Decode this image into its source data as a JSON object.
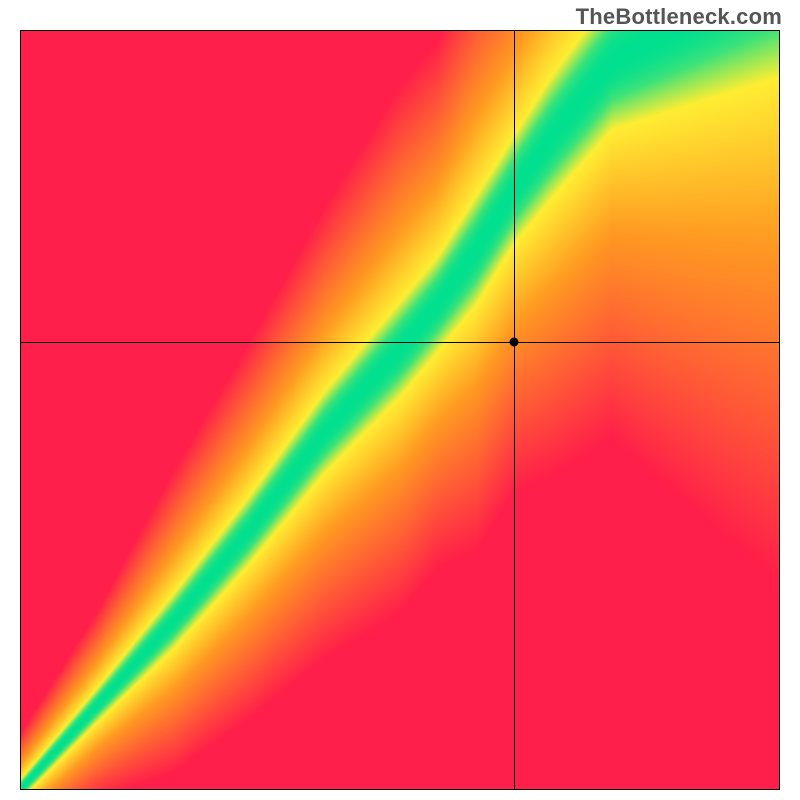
{
  "watermark": "TheBottleneck.com",
  "chart_data": {
    "type": "heatmap",
    "title": "",
    "xlabel": "",
    "ylabel": "",
    "xlim": [
      0,
      100
    ],
    "ylim": [
      0,
      100
    ],
    "grid": false,
    "legend": false,
    "crosshair": {
      "x": 65.2,
      "y": 58.8
    },
    "optimal_band": {
      "description": "Green band of optimal pairing; diagonal curve widening toward top-right",
      "points": [
        {
          "x": 0,
          "center": 0,
          "width": 1.5
        },
        {
          "x": 10,
          "center": 11,
          "width": 2.5
        },
        {
          "x": 20,
          "center": 22,
          "width": 4
        },
        {
          "x": 30,
          "center": 34,
          "width": 5
        },
        {
          "x": 40,
          "center": 47,
          "width": 6
        },
        {
          "x": 50,
          "center": 58,
          "width": 7
        },
        {
          "x": 55,
          "center": 64,
          "width": 7
        },
        {
          "x": 60,
          "center": 71,
          "width": 8
        },
        {
          "x": 65,
          "center": 79,
          "width": 8
        },
        {
          "x": 70,
          "center": 86,
          "width": 9
        },
        {
          "x": 78,
          "center": 96,
          "width": 10
        },
        {
          "x": 85,
          "center": 100,
          "width": 12
        }
      ]
    },
    "color_scale": {
      "optimal": "#00e090",
      "near": "#ffee33",
      "mid": "#ff9a22",
      "far": "#ff1f4a"
    }
  }
}
